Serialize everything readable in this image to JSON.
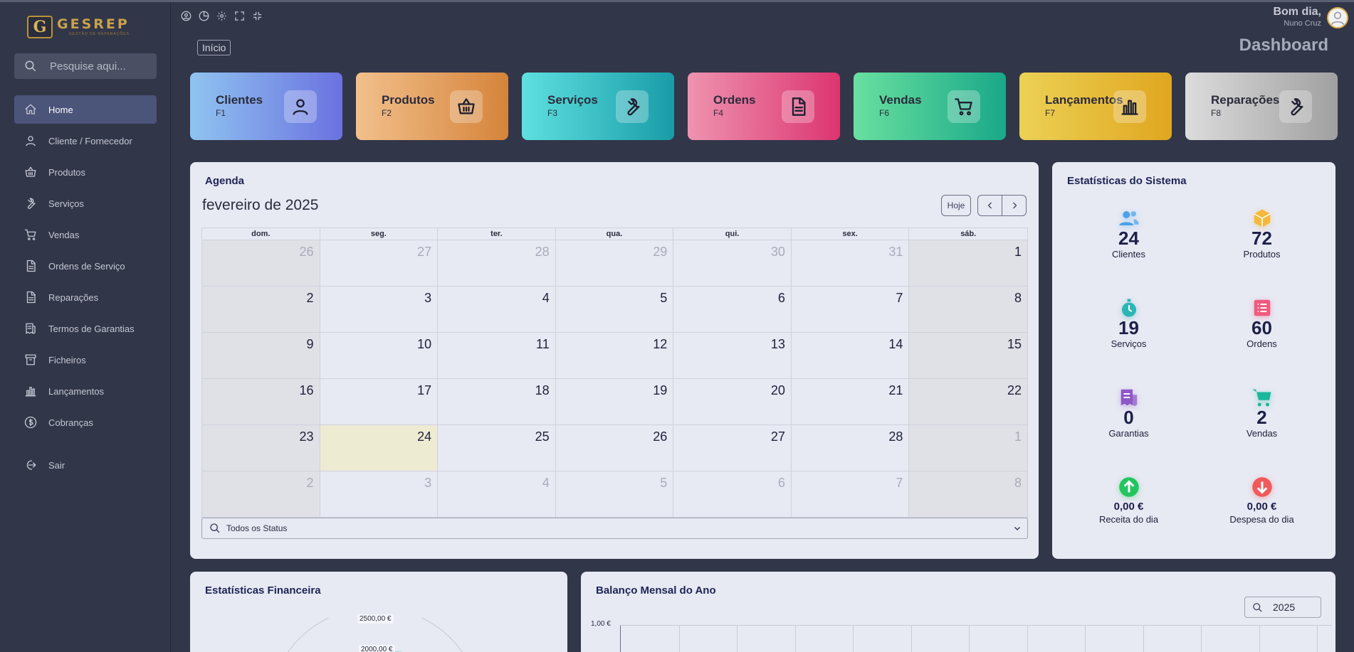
{
  "colors": {
    "bg": "#323649",
    "sidebar_active": "#4b5479",
    "panel": "#e7e9f3",
    "today": "#eeebd3"
  },
  "logo": {
    "letter": "G",
    "title": "GESREP",
    "subtitle": "GESTÃO DE REPARAÇÕES"
  },
  "search": {
    "placeholder": "Pesquise aqui..."
  },
  "nav": [
    {
      "label": "Home",
      "icon": "home-icon",
      "active": true
    },
    {
      "label": "Cliente / Fornecedor",
      "icon": "user-icon"
    },
    {
      "label": "Produtos",
      "icon": "basket-icon"
    },
    {
      "label": "Serviços",
      "icon": "wrench-icon"
    },
    {
      "label": "Vendas",
      "icon": "cart-icon"
    },
    {
      "label": "Ordens de Serviço",
      "icon": "document-icon"
    },
    {
      "label": "Reparações",
      "icon": "document-icon"
    },
    {
      "label": "Termos de Garantias",
      "icon": "receipt-icon"
    },
    {
      "label": "Ficheiros",
      "icon": "archive-icon"
    },
    {
      "label": "Lançamentos",
      "icon": "chart-icon"
    },
    {
      "label": "Cobranças",
      "icon": "dollar-icon"
    }
  ],
  "logout": {
    "label": "Sair",
    "icon": "logout-icon"
  },
  "header": {
    "greeting": "Bom dia,",
    "user": "Nuno Cruz",
    "breadcrumb": "Início",
    "title": "Dashboard"
  },
  "cards": [
    {
      "label": "Clientes",
      "key": "F1",
      "icon": "user-icon",
      "gradient": [
        "#8fc4f0",
        "#6b72e0"
      ]
    },
    {
      "label": "Produtos",
      "key": "F2",
      "icon": "basket-icon",
      "gradient": [
        "#f2c08c",
        "#d5843a"
      ]
    },
    {
      "label": "Serviços",
      "key": "F3",
      "icon": "wrench-icon",
      "gradient": [
        "#5ee0e0",
        "#1a9ca8"
      ]
    },
    {
      "label": "Ordens",
      "key": "F4",
      "icon": "document-icon",
      "gradient": [
        "#ee93b0",
        "#dc3570"
      ]
    },
    {
      "label": "Vendas",
      "key": "F6",
      "icon": "cart-icon",
      "gradient": [
        "#69e0a0",
        "#1aa888"
      ]
    },
    {
      "label": "Lançamentos",
      "key": "F7",
      "icon": "chart-icon",
      "gradient": [
        "#ecd155",
        "#e0a620"
      ]
    },
    {
      "label": "Reparações",
      "key": "F8",
      "icon": "wrench-icon",
      "gradient": [
        "#dcdcdc",
        "#a0a0a0"
      ]
    }
  ],
  "agenda": {
    "title": "Agenda",
    "month": "fevereiro de 2025",
    "today_label": "Hoje",
    "weekdays": [
      "dom.",
      "seg.",
      "ter.",
      "qua.",
      "qui.",
      "sex.",
      "sáb."
    ],
    "weeks": [
      [
        [
          "26",
          1
        ],
        [
          "27",
          1
        ],
        [
          "28",
          1
        ],
        [
          "29",
          1
        ],
        [
          "30",
          1
        ],
        [
          "31",
          1
        ],
        [
          "1",
          0
        ]
      ],
      [
        [
          "2",
          0
        ],
        [
          "3",
          0
        ],
        [
          "4",
          0
        ],
        [
          "5",
          0
        ],
        [
          "6",
          0
        ],
        [
          "7",
          0
        ],
        [
          "8",
          0
        ]
      ],
      [
        [
          "9",
          0
        ],
        [
          "10",
          0
        ],
        [
          "11",
          0
        ],
        [
          "12",
          0
        ],
        [
          "13",
          0
        ],
        [
          "14",
          0
        ],
        [
          "15",
          0
        ]
      ],
      [
        [
          "16",
          0
        ],
        [
          "17",
          0
        ],
        [
          "18",
          0
        ],
        [
          "19",
          0
        ],
        [
          "20",
          0
        ],
        [
          "21",
          0
        ],
        [
          "22",
          0
        ]
      ],
      [
        [
          "23",
          0
        ],
        [
          "24",
          2
        ],
        [
          "25",
          0
        ],
        [
          "26",
          0
        ],
        [
          "27",
          0
        ],
        [
          "28",
          0
        ],
        [
          "1",
          1
        ]
      ],
      [
        [
          "2",
          1
        ],
        [
          "3",
          1
        ],
        [
          "4",
          1
        ],
        [
          "5",
          1
        ],
        [
          "6",
          1
        ],
        [
          "7",
          1
        ],
        [
          "8",
          1
        ]
      ]
    ],
    "status_filter": "Todos os Status"
  },
  "stats": {
    "title": "Estatísticas do Sistema",
    "items": [
      {
        "value": "24",
        "label": "Clientes",
        "icon": "users-icon",
        "color": "#4aa3e8"
      },
      {
        "value": "72",
        "label": "Produtos",
        "icon": "box-icon",
        "color": "#f5b83d"
      },
      {
        "value": "19",
        "label": "Serviços",
        "icon": "stopwatch-icon",
        "color": "#2bb5b5"
      },
      {
        "value": "60",
        "label": "Ordens",
        "icon": "list-icon",
        "color": "#f05a7e"
      },
      {
        "value": "0",
        "label": "Garantias",
        "icon": "receipt-icon",
        "color": "#8e58c8"
      },
      {
        "value": "2",
        "label": "Vendas",
        "icon": "cart-icon",
        "color": "#1ab89a"
      },
      {
        "value": "0,00 €",
        "label": "Receita do dia",
        "icon": "arrow-up-icon",
        "color": "#22c55e"
      },
      {
        "value": "0,00 €",
        "label": "Despesa do dia",
        "icon": "arrow-down-icon",
        "color": "#f05a5a"
      }
    ]
  },
  "financial": {
    "title": "Estatísticas Financeira",
    "labels": [
      "2500,00 €",
      "2000,00 €"
    ]
  },
  "balance": {
    "title": "Balanço Mensal do Ano",
    "year": "2025",
    "ytick": "1,00 €"
  }
}
